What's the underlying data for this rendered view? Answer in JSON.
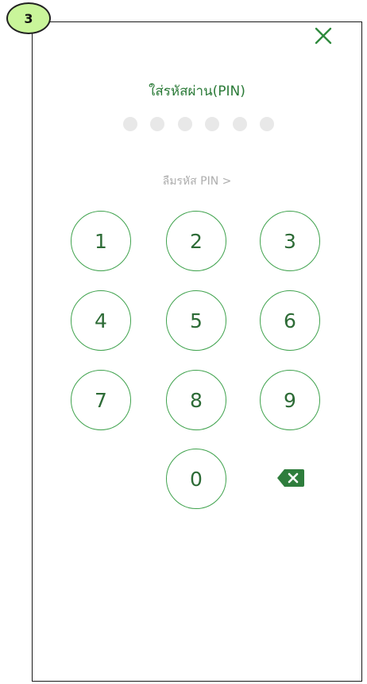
{
  "step_badge": "3",
  "pin_screen": {
    "title": "ใส่รหัสผ่าน(PIN)",
    "forgot_link": "ลืมรหัส PIN >",
    "keys": [
      "1",
      "2",
      "3",
      "4",
      "5",
      "6",
      "7",
      "8",
      "9",
      "0"
    ],
    "dot_count_label": "6",
    "close_icon": "close-icon",
    "backspace_icon": "backspace-icon"
  },
  "colors": {
    "accent": "#2a7a37",
    "key_border": "#3fa24d",
    "dot_inactive": "#e8e8e8",
    "hint_text": "#aeaeae",
    "badge_fill": "#c9f59a"
  }
}
